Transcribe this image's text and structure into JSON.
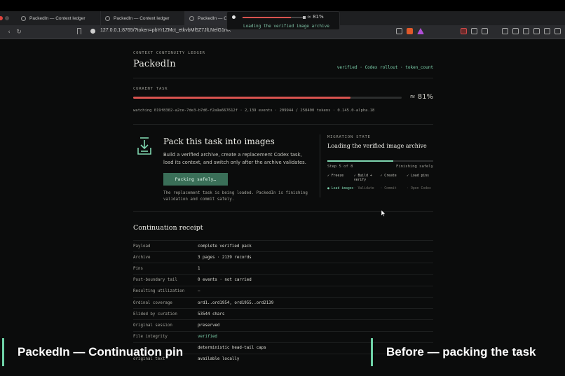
{
  "browser": {
    "tabs": [
      {
        "label": "PackedIn — Context ledger"
      },
      {
        "label": "PackedIn — Context ledger"
      },
      {
        "label": "PackedIn — C"
      }
    ],
    "url": "127.0.0.1:8765/?token=pbYr1ZMct_etkvbMl5Z7JlLNelG1rxk"
  },
  "popup": {
    "percent": "≈ 81%",
    "progress": 0.8,
    "message": "Loading the verified image archive"
  },
  "header": {
    "eyebrow": "CONTEXT CONTINUITY LEDGER",
    "title": "PackedIn",
    "pills": "verified · Codex rollout · token_count"
  },
  "current_task": {
    "eyebrow": "CURRENT TASK",
    "percent_label": "≈ 81%",
    "progress": 0.81,
    "watching": "watching 019f8302-a2ce-7de3-b7d6-f2a9a667612f · 2,139 events · 209944 / 258400 tokens · 0.145.0-alpha.18"
  },
  "pack": {
    "title": "Pack this task into images",
    "description": "Build a verified archive, create a replacement Codex task, load its context, and switch only after the archive validates.",
    "button": "Packing safely…",
    "note": "The replacement task is being loaded. PackedIn is finishing validation and commit safely."
  },
  "migration": {
    "eyebrow": "MIGRATION STATE",
    "title": "Loading the verified image archive",
    "progress": 0.625,
    "step_label": "Step 5 of 8",
    "status": "Finishing safely",
    "steps": [
      {
        "label": "✓ Freeze",
        "state": "done"
      },
      {
        "label": "✓ Build + verify",
        "state": "done"
      },
      {
        "label": "✓ Create",
        "state": "done"
      },
      {
        "label": "✓ Load pins",
        "state": "done"
      },
      {
        "label": "● Load images",
        "state": "active"
      },
      {
        "label": "· Validate",
        "state": "pending"
      },
      {
        "label": "· Commit",
        "state": "pending"
      },
      {
        "label": "· Open Codex",
        "state": "pending"
      }
    ]
  },
  "receipt": {
    "title": "Continuation receipt",
    "rows": [
      {
        "key": "Payload",
        "value": "complete verified pack"
      },
      {
        "key": "Archive",
        "value": "3 pages · 2139 records"
      },
      {
        "key": "Pins",
        "value": "1"
      },
      {
        "key": "Post-boundary tail",
        "value": "0 events · not carried"
      },
      {
        "key": "Resulting utilization",
        "value": "—"
      },
      {
        "key": "Ordinal coverage",
        "value": "ord1..ord1954, ord1955..ord2139"
      },
      {
        "key": "Elided by curation",
        "value": "53544 chars"
      },
      {
        "key": "Original session",
        "value": "preserved"
      },
      {
        "key": "File integrity",
        "value": "verified",
        "green": true
      },
      {
        "key": "",
        "value": "deterministic head-tail caps"
      },
      {
        "key": "original text",
        "value": "available locally"
      }
    ]
  },
  "captions": {
    "left": "PackedIn — Continuation pin",
    "right": "Before — packing the task"
  },
  "colors": {
    "accent_green": "#7fd6b0",
    "progress_red": "#d9534f",
    "button_green": "#3a6f58"
  }
}
